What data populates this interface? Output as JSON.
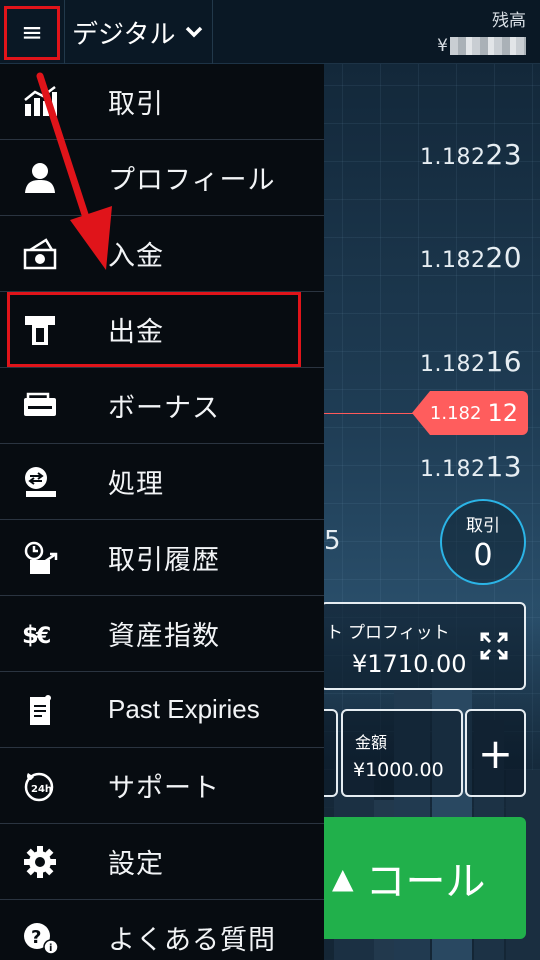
{
  "topbar": {
    "menu_glyph": "≡",
    "asset_label": "デジタル",
    "balance_label": "残高",
    "balance_currency": "¥"
  },
  "menu": {
    "items": [
      {
        "label": "取引",
        "icon": "chart-icon"
      },
      {
        "label": "プロフィール",
        "icon": "user-icon"
      },
      {
        "label": "入金",
        "icon": "deposit-icon"
      },
      {
        "label": "出金",
        "icon": "withdraw-atm-icon"
      },
      {
        "label": "ボーナス",
        "icon": "bonus-icon"
      },
      {
        "label": "処理",
        "icon": "processing-icon"
      },
      {
        "label": "取引履歴",
        "icon": "history-icon"
      },
      {
        "label": "資産指数",
        "icon": "asset-index-icon"
      },
      {
        "label": "Past Expiries",
        "icon": "document-icon"
      },
      {
        "label": "サポート",
        "icon": "support-24h-icon"
      },
      {
        "label": "設定",
        "icon": "gear-icon"
      },
      {
        "label": "よくある質問",
        "icon": "faq-icon"
      }
    ],
    "highlighted_item": "出金"
  },
  "chart": {
    "prices": [
      {
        "main": "1.182",
        "tail": "23"
      },
      {
        "main": "1.182",
        "tail": "20"
      },
      {
        "main": "1.182",
        "tail": "16"
      },
      {
        "main": "1.182",
        "tail": "13"
      }
    ],
    "current_price": {
      "main": "1.182",
      "tail": "12"
    },
    "partial_digit": "5"
  },
  "trade": {
    "counter_label": "取引",
    "counter_value": "0",
    "profit_label_prefix": "ト",
    "profit_label": "プロフィット",
    "profit_value": "¥1710.00",
    "amount_label": "金額",
    "amount_value": "¥1000.00",
    "plus": "+",
    "call_label": "コール",
    "call_triangle": "▲"
  },
  "colors": {
    "call_green": "#21b04b",
    "current_price_red": "#ff5d5d",
    "annotation_red": "#e0141a",
    "circle_blue": "#2bb4e6"
  }
}
